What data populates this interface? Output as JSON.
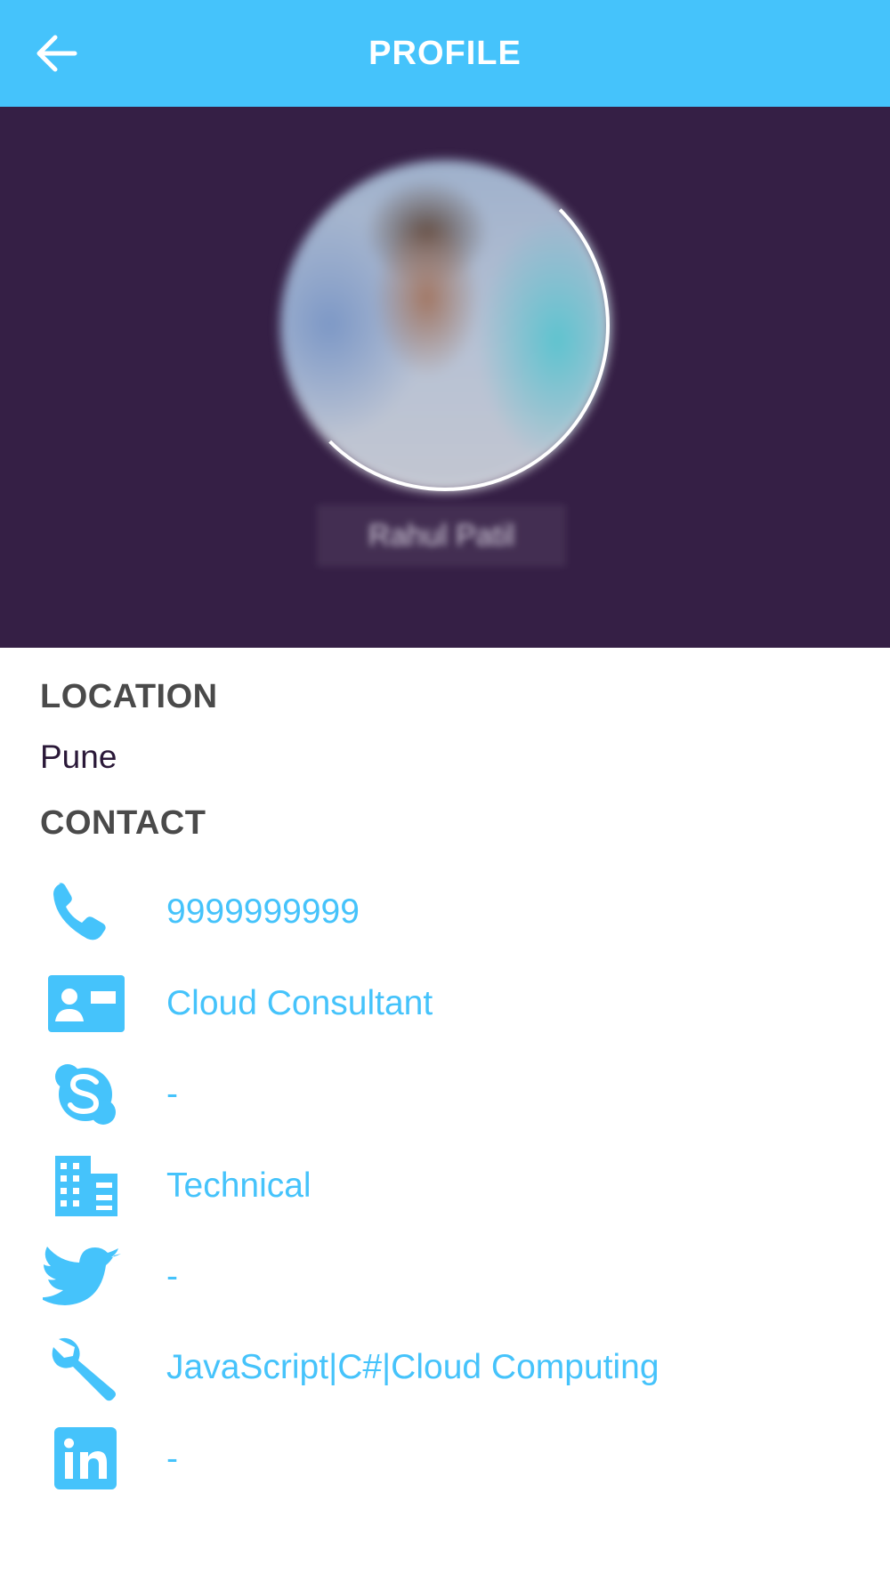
{
  "header": {
    "title": "PROFILE",
    "back_icon": "arrow-left-icon"
  },
  "profile": {
    "name": "Rahul Patil",
    "avatar": "blurred-profile-photo"
  },
  "location": {
    "label": "LOCATION",
    "value": "Pune"
  },
  "contact": {
    "label": "CONTACT",
    "items": [
      {
        "icon": "phone-icon",
        "value": "9999999999"
      },
      {
        "icon": "id-card-icon",
        "value": "Cloud Consultant"
      },
      {
        "icon": "skype-icon",
        "value": "-"
      },
      {
        "icon": "building-icon",
        "value": "Technical"
      },
      {
        "icon": "twitter-icon",
        "value": "-"
      },
      {
        "icon": "wrench-icon",
        "value": "JavaScript|C#|Cloud Computing"
      },
      {
        "icon": "linkedin-icon",
        "value": "-"
      }
    ]
  },
  "colors": {
    "header_bg": "#45c3fb",
    "hero_bg": "#351f45",
    "accent": "#45c3fb",
    "label_text": "#4a4a4a"
  }
}
